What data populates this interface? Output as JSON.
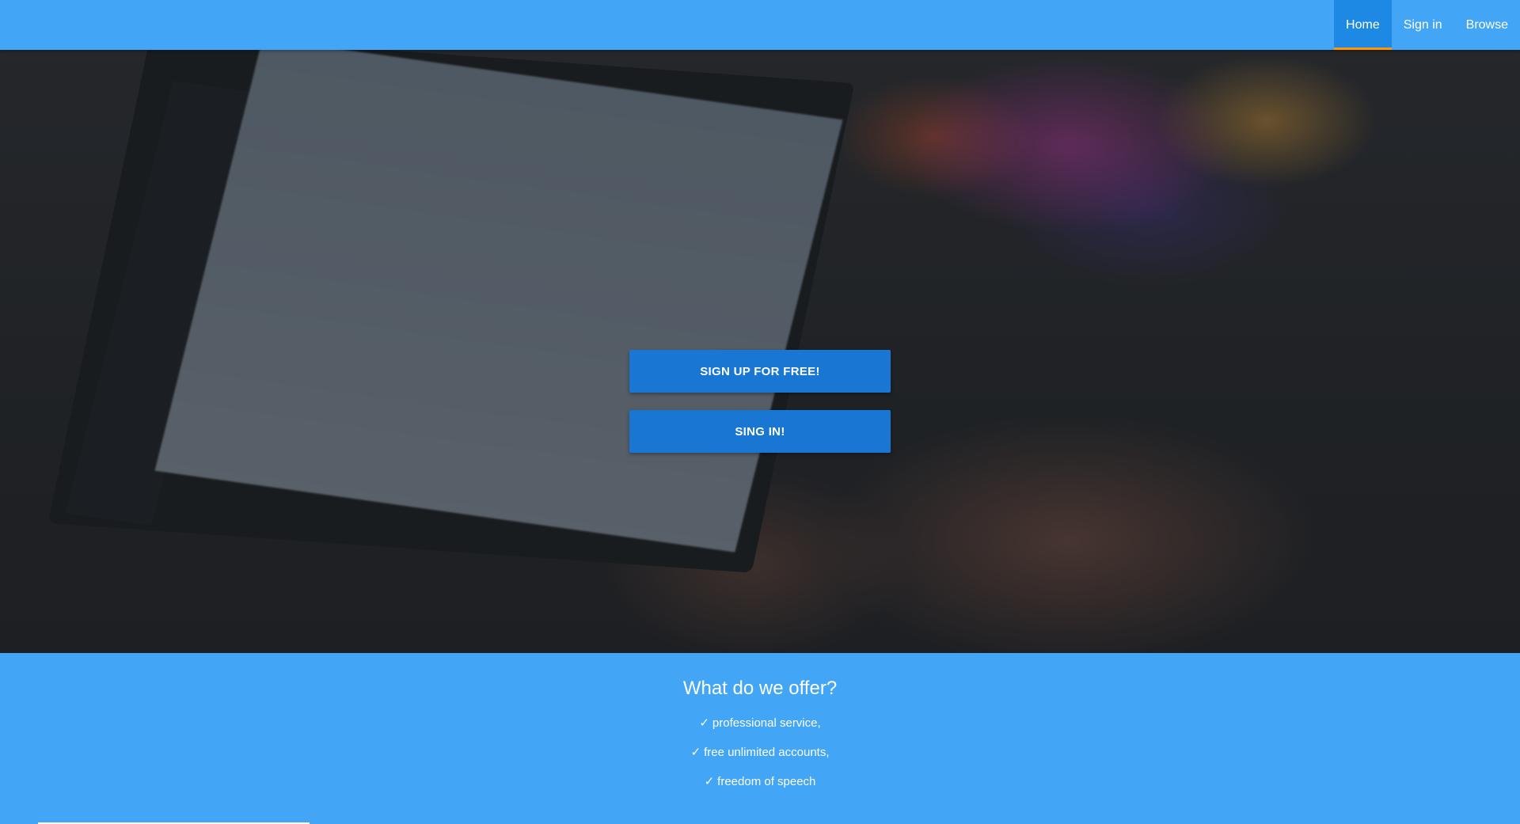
{
  "nav": {
    "items": [
      {
        "label": "Home",
        "active": true
      },
      {
        "label": "Sign in",
        "active": false
      },
      {
        "label": "Browse",
        "active": false
      }
    ]
  },
  "hero": {
    "signup_label": "SIGN UP FOR FREE!",
    "signin_label": "SING IN!"
  },
  "offer": {
    "title": "What do we offer?",
    "check_glyph": "✓",
    "items": [
      "professional service,",
      "free unlimited accounts,",
      "freedom of speech"
    ]
  },
  "colors": {
    "primary": "#42a5f5",
    "button": "#1976d2",
    "active_nav": "#1e88e5",
    "active_indicator": "#ff9800"
  }
}
